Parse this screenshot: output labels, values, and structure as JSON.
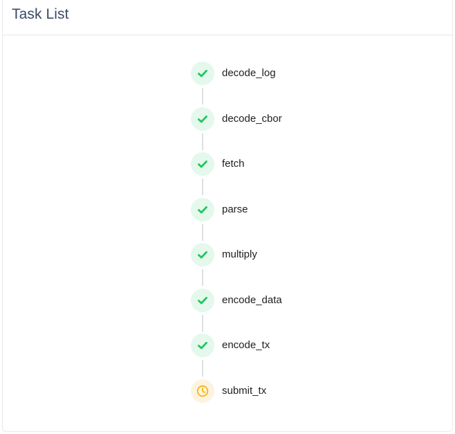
{
  "header": {
    "title": "Task List"
  },
  "colors": {
    "complete": "#22c55e",
    "complete_bg": "#e4f8ec",
    "pending": "#f5b512",
    "pending_bg": "#fdf4e0"
  },
  "tasks": [
    {
      "label": "decode_log",
      "status": "complete",
      "icon": "check-icon"
    },
    {
      "label": "decode_cbor",
      "status": "complete",
      "icon": "check-icon"
    },
    {
      "label": "fetch",
      "status": "complete",
      "icon": "check-icon"
    },
    {
      "label": "parse",
      "status": "complete",
      "icon": "check-icon"
    },
    {
      "label": "multiply",
      "status": "complete",
      "icon": "check-icon"
    },
    {
      "label": "encode_data",
      "status": "complete",
      "icon": "check-icon"
    },
    {
      "label": "encode_tx",
      "status": "complete",
      "icon": "check-icon"
    },
    {
      "label": "submit_tx",
      "status": "pending",
      "icon": "clock-icon"
    }
  ]
}
